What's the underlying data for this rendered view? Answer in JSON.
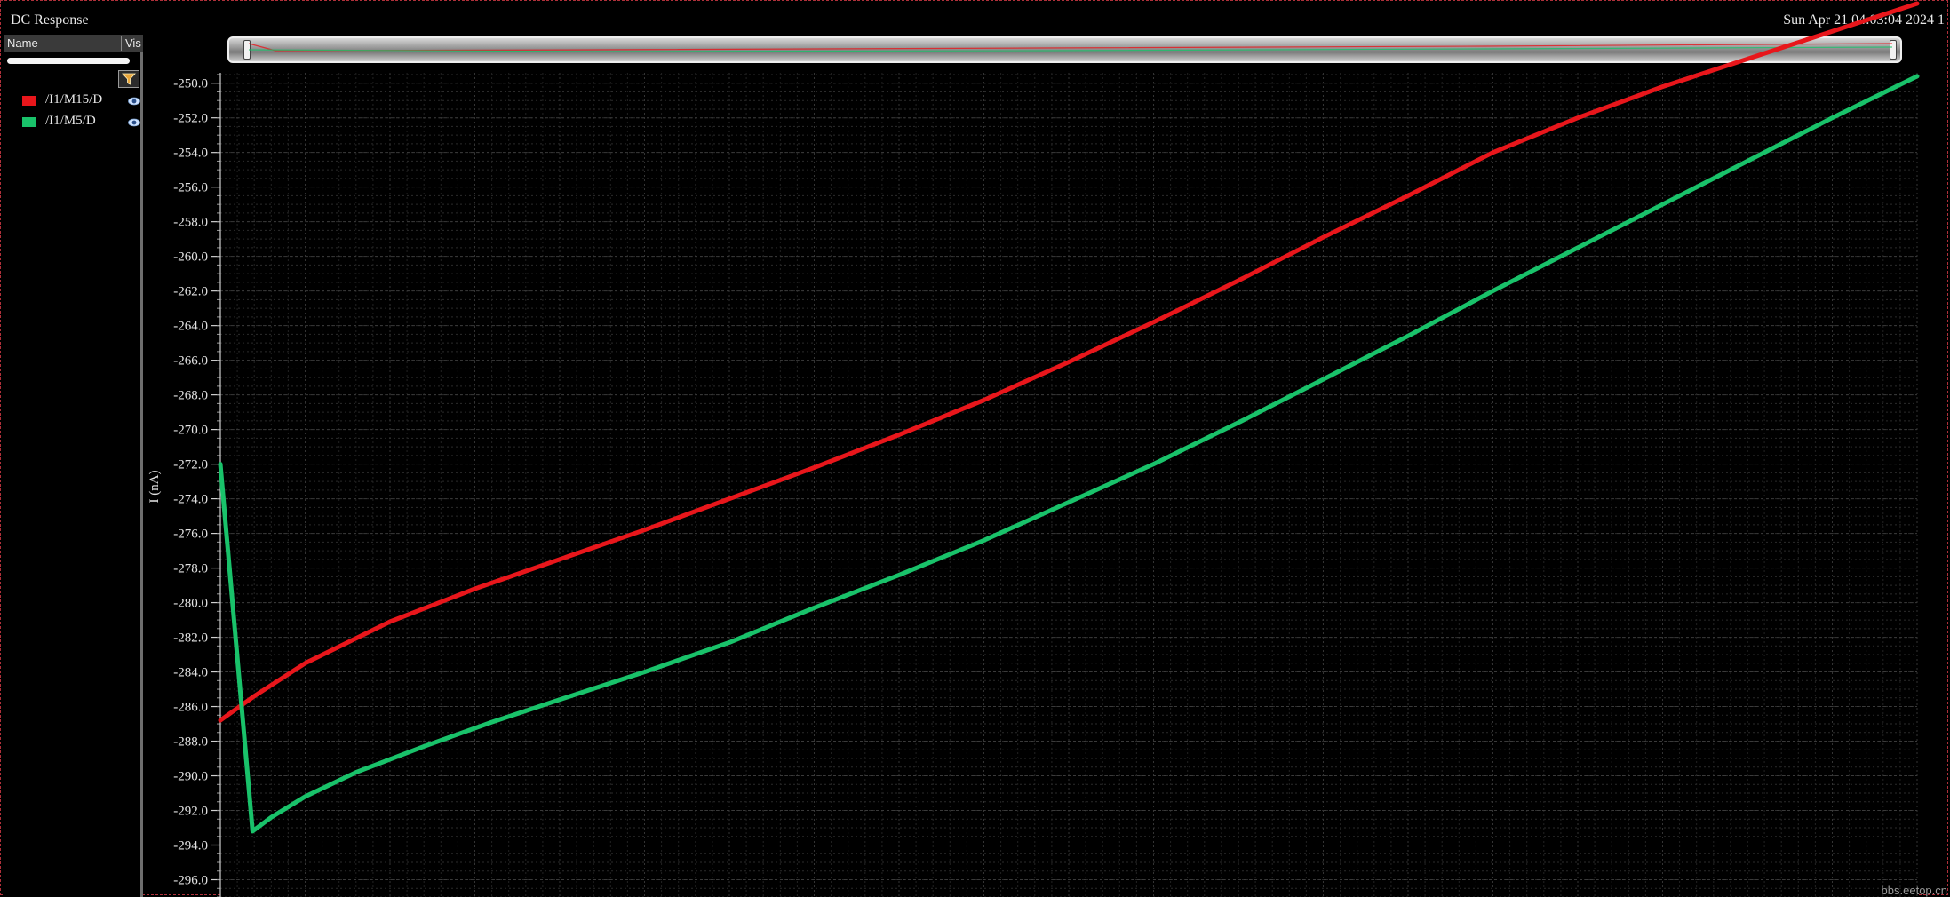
{
  "window": {
    "title": "DC Response",
    "datetime": "Sun Apr 21 04:03:04 2024  1"
  },
  "legend": {
    "columns": {
      "name": "Name",
      "vis": "Vis"
    },
    "filter_icon": "filter-funnel-icon",
    "visibility_icon": "eye-icon",
    "traces": [
      {
        "label": "/I1/M15/D",
        "color": "#e8161b"
      },
      {
        "label": "/I1/M5/D",
        "color": "#19c26a"
      }
    ]
  },
  "watermark": "bbs.eetop.cn",
  "chart_data": {
    "type": "line",
    "ylabel": "I (nA)",
    "ylim": [
      -297.0,
      -249.4
    ],
    "yticks": [
      "-250.0",
      "-252.0",
      "-254.0",
      "-256.0",
      "-258.0",
      "-260.0",
      "-262.0",
      "-264.0",
      "-266.0",
      "-268.0",
      "-270.0",
      "-272.0",
      "-274.0",
      "-276.0",
      "-278.0",
      "-280.0",
      "-282.0",
      "-284.0",
      "-286.0",
      "-288.0",
      "-290.0",
      "-292.0",
      "-294.0",
      "-296.0"
    ],
    "xlim": [
      0,
      100
    ],
    "grid": true,
    "legend_position": "left-panel",
    "series": [
      {
        "name": "/I1/M15/D",
        "color": "#e8161b",
        "x": [
          0,
          2,
          5,
          10,
          15,
          20,
          25,
          30,
          35,
          40,
          45,
          50,
          55,
          60,
          65,
          70,
          75,
          80,
          85,
          90,
          95,
          100
        ],
        "y": [
          -286.8,
          -285.4,
          -283.5,
          -281.1,
          -279.2,
          -277.5,
          -275.8,
          -274.0,
          -272.2,
          -270.3,
          -268.3,
          -266.1,
          -263.8,
          -261.4,
          -258.9,
          -256.5,
          -254.0,
          -252.0,
          -250.2,
          -248.6,
          -247.0,
          -245.4
        ]
      },
      {
        "name": "/I1/M5/D",
        "color": "#19c26a",
        "x": [
          0,
          1.9,
          3,
          5,
          8,
          12,
          16,
          20,
          25,
          30,
          35,
          40,
          45,
          50,
          55,
          60,
          65,
          70,
          75,
          80,
          85,
          90,
          95,
          100
        ],
        "y": [
          -272.0,
          -293.2,
          -292.4,
          -291.2,
          -289.8,
          -288.3,
          -286.9,
          -285.6,
          -284.0,
          -282.3,
          -280.3,
          -278.4,
          -276.4,
          -274.2,
          -272.0,
          -269.6,
          -267.1,
          -264.6,
          -262.0,
          -259.5,
          -257.0,
          -254.5,
          -252.0,
          -249.6
        ]
      }
    ]
  }
}
